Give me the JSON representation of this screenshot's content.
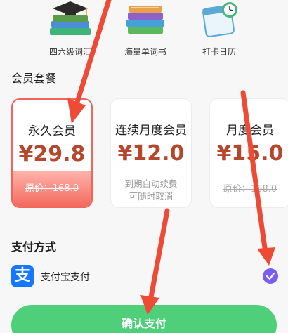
{
  "features": [
    {
      "label": "四六级词汇",
      "icon": "graduation-books-icon"
    },
    {
      "label": "海量单词书",
      "icon": "book-stack-icon"
    },
    {
      "label": "打卡日历",
      "icon": "calendar-clock-icon"
    }
  ],
  "plans_title": "会员套餐",
  "plans": [
    {
      "name": "永久会员",
      "price": "¥29.8",
      "original": "原价：168.0",
      "selected": true
    },
    {
      "name": "连续月度会员",
      "price": "¥12.0",
      "note_line1": "到期自动续费",
      "note_line2": "可随时取消"
    },
    {
      "name": "月度会员",
      "price": "¥15.0",
      "original": "原价：168.0"
    }
  ],
  "payment_title": "支付方式",
  "payment": {
    "logo_char": "支",
    "label": "支付宝支付",
    "checked": true
  },
  "confirm_label": "确认支付",
  "colors": {
    "accent": "#7b5cf5",
    "confirm": "#4fcf7a",
    "price": "#b4472c",
    "selected_border": "#f2655a",
    "arrow": "#ee4a35"
  }
}
